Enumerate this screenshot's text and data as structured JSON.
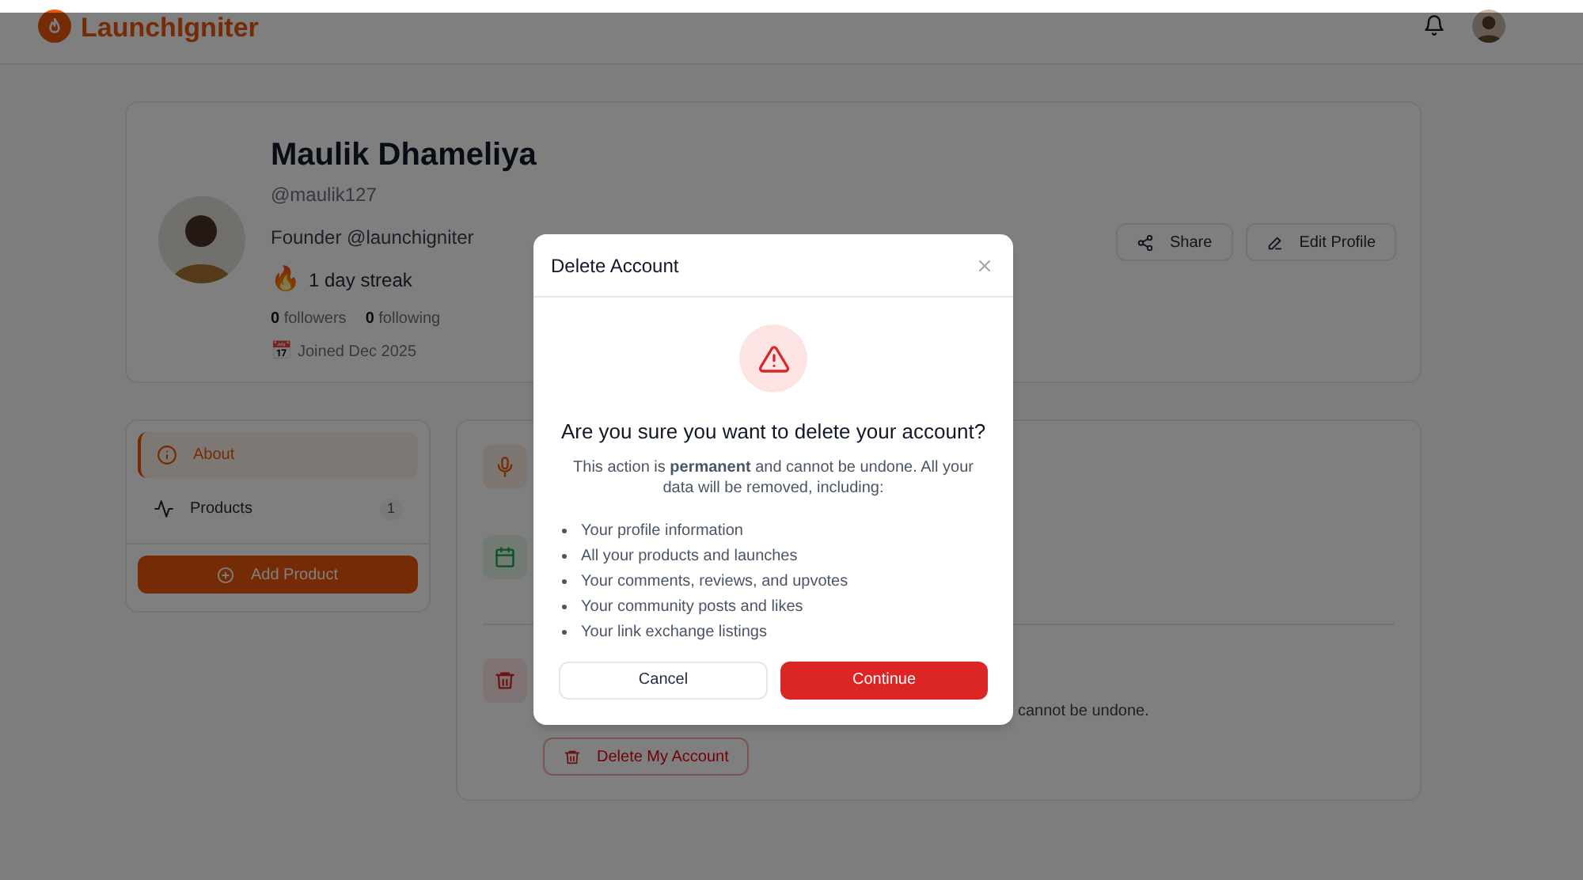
{
  "header": {
    "brand": "LaunchIgniter"
  },
  "profile": {
    "name": "Maulik Dhameliya",
    "handle": "@maulik127",
    "bio": "Founder @launchigniter",
    "streak_icon": "🔥",
    "streak": "1 day streak",
    "followers_count": "0",
    "followers_label": "followers",
    "following_count": "0",
    "following_label": "following",
    "joined_icon": "📅",
    "joined": "Joined Dec 2025",
    "actions": [
      {
        "kind": "share",
        "label": "Share"
      },
      {
        "kind": "edit",
        "label": "Edit Profile"
      }
    ]
  },
  "sidebar": {
    "items": [
      {
        "kind": "info",
        "label": "About",
        "selected": true
      },
      {
        "kind": "activity",
        "label": "Products",
        "count": "1",
        "selected": false
      }
    ],
    "add_button": "Add Product"
  },
  "main": {
    "sections": [
      {
        "kind": "mic"
      },
      {
        "kind": "calendar"
      },
      {
        "kind": "danger",
        "text_fragment": "cannot be undone.",
        "button": "Delete My Account"
      }
    ]
  },
  "dialog": {
    "title": "Delete Account",
    "heading": "Are you sure you want to delete your account?",
    "message": "This action is **permanent** and cannot be undone. All your data will be removed, including:",
    "items": [
      "Your profile information",
      "All your products and launches",
      "Your comments, reviews, and upvotes",
      "Your community posts and likes",
      "Your link exchange listings"
    ],
    "cancel": "Cancel",
    "confirm": "Continue"
  }
}
